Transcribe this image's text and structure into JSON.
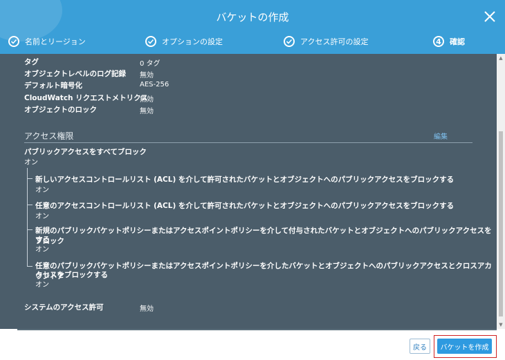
{
  "header": {
    "title": "バケットの作成"
  },
  "steps": [
    {
      "label": "名前とリージョン"
    },
    {
      "label": "オプションの設定"
    },
    {
      "label": "アクセス許可の設定"
    },
    {
      "num": "4",
      "label": "確認"
    }
  ],
  "properties": [
    {
      "key": "タグ",
      "value": "0 タグ"
    },
    {
      "key": "オブジェクトレベルのログ記録",
      "value": "無効"
    },
    {
      "key": "デフォルト暗号化",
      "value": "AES-256"
    },
    {
      "key": "CloudWatch リクエストメトリクス",
      "value": "無効"
    },
    {
      "key": "オブジェクトのロック",
      "value": "無効"
    }
  ],
  "access": {
    "title": "アクセス権限",
    "edit_label": "編集",
    "block_all_label": "パブリックアクセスをすべてブロック",
    "block_all_value": "オン",
    "items": [
      {
        "lines": [
          "新しいアクセスコントロールリスト (ACL) を介して許可されたバケットとオブジェクトへのパブリックアクセスをブロックする"
        ],
        "value": "オン"
      },
      {
        "lines": [
          "任意のアクセスコントロールリスト (ACL) を介して許可されたバケットとオブジェクトへのパブリックアクセスをブロックする"
        ],
        "value": "オン"
      },
      {
        "lines": [
          "新規のパブリックバケットポリシーまたはアクセスポイントポリシーを介して付与されたバケットとオブジェクトへのパブリックアクセスをブロック",
          "する"
        ],
        "value": "オン"
      },
      {
        "lines": [
          "任意のパブリックバケットポリシーまたはアクセスポイントポリシーを介したバケットとオブジェクトへのパブリックアクセスとクロスアカウントア",
          "クセスをブロックする"
        ],
        "value": "オン"
      }
    ]
  },
  "system": {
    "label": "システムのアクセス許可",
    "value": "無効"
  },
  "buttons": {
    "back": "戻る",
    "create": "バケットを作成"
  },
  "colors": {
    "header": "#3a9fd8",
    "panel": "#4b5d6a",
    "primary_button": "#2e9ae0",
    "highlight_border": "#d02020"
  }
}
